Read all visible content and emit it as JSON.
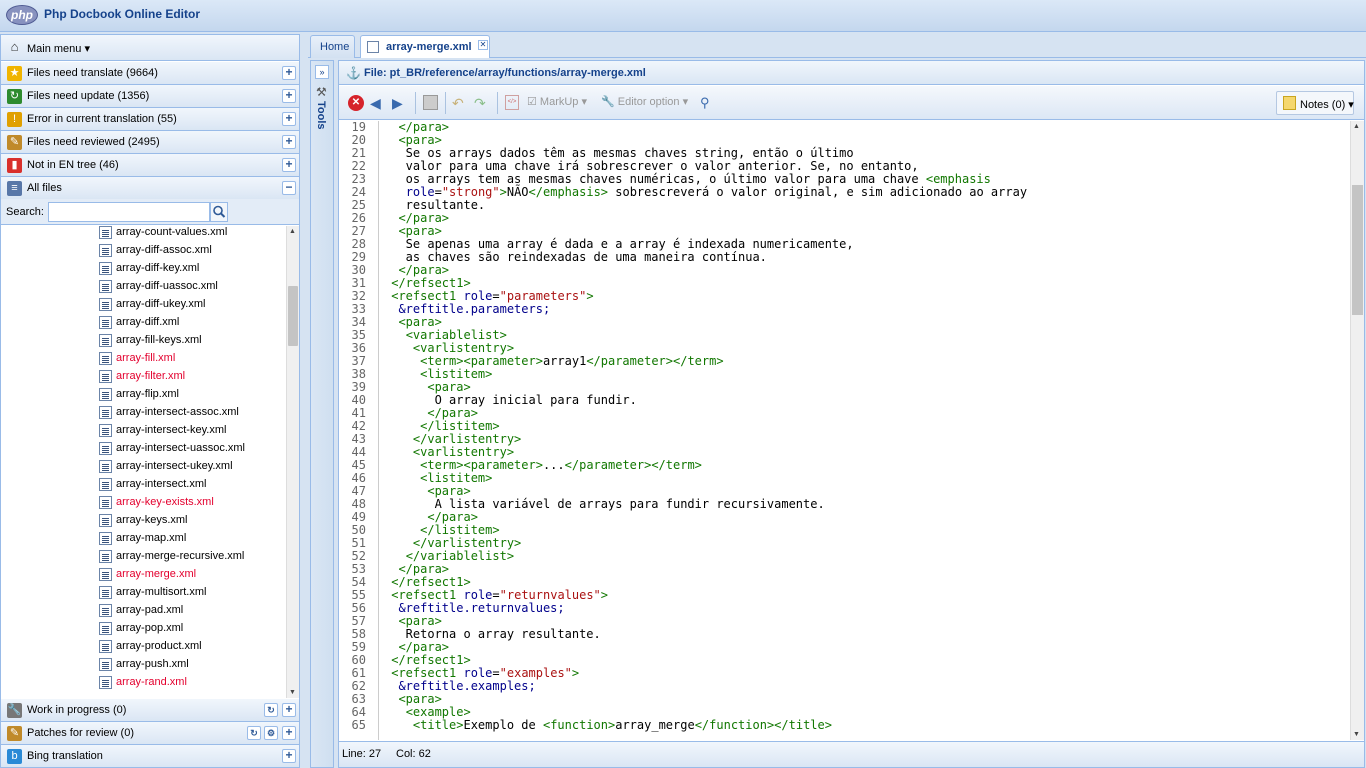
{
  "app": {
    "title": "Php Docbook Online Editor",
    "logo_text": "php"
  },
  "sidebar": {
    "main_menu": "Main menu",
    "sections": [
      {
        "label": "Files need translate (9664)",
        "icon": "translate-icon",
        "color": "#f0b400"
      },
      {
        "label": "Files need update (1356)",
        "icon": "refresh-icon",
        "color": "#2e8b2e"
      },
      {
        "label": "Error in current translation (55)",
        "icon": "warning-shield-icon",
        "color": "#e0a000"
      },
      {
        "label": "Files need reviewed (2495)",
        "icon": "pencil-icon",
        "color": "#c08a2a"
      },
      {
        "label": "Not in EN tree (46)",
        "icon": "trash-icon",
        "color": "#d9302c"
      },
      {
        "label": "All files",
        "icon": "file-list-icon",
        "color": "#5877a8"
      }
    ],
    "search": {
      "label": "Search:",
      "value": "",
      "placeholder": ""
    },
    "files": [
      {
        "name": "array-count-values.xml",
        "red": false
      },
      {
        "name": "array-diff-assoc.xml",
        "red": false
      },
      {
        "name": "array-diff-key.xml",
        "red": false
      },
      {
        "name": "array-diff-uassoc.xml",
        "red": false
      },
      {
        "name": "array-diff-ukey.xml",
        "red": false
      },
      {
        "name": "array-diff.xml",
        "red": false
      },
      {
        "name": "array-fill-keys.xml",
        "red": false
      },
      {
        "name": "array-fill.xml",
        "red": true
      },
      {
        "name": "array-filter.xml",
        "red": true
      },
      {
        "name": "array-flip.xml",
        "red": false
      },
      {
        "name": "array-intersect-assoc.xml",
        "red": false
      },
      {
        "name": "array-intersect-key.xml",
        "red": false
      },
      {
        "name": "array-intersect-uassoc.xml",
        "red": false
      },
      {
        "name": "array-intersect-ukey.xml",
        "red": false
      },
      {
        "name": "array-intersect.xml",
        "red": false
      },
      {
        "name": "array-key-exists.xml",
        "red": true
      },
      {
        "name": "array-keys.xml",
        "red": false
      },
      {
        "name": "array-map.xml",
        "red": false
      },
      {
        "name": "array-merge-recursive.xml",
        "red": false
      },
      {
        "name": "array-merge.xml",
        "red": true
      },
      {
        "name": "array-multisort.xml",
        "red": false
      },
      {
        "name": "array-pad.xml",
        "red": false
      },
      {
        "name": "array-pop.xml",
        "red": false
      },
      {
        "name": "array-product.xml",
        "red": false
      },
      {
        "name": "array-push.xml",
        "red": false
      },
      {
        "name": "array-rand.xml",
        "red": true
      }
    ],
    "bottom_sections": [
      {
        "label": "Work in progress (0)",
        "icon": "wrench-icon"
      },
      {
        "label": "Patches for review (0)",
        "icon": "patch-icon"
      },
      {
        "label": "Bing translation",
        "icon": "bing-icon"
      }
    ]
  },
  "tabs": {
    "home": "Home",
    "file": "array-merge.xml"
  },
  "tools": {
    "label": "Tools"
  },
  "editor": {
    "file_title": "File: pt_BR/reference/array/functions/array-merge.xml",
    "toolbar": {
      "markup": "MarkUp",
      "editor_option": "Editor option",
      "notes": "Notes (0)"
    },
    "status": {
      "line": "Line: 27",
      "col": "Col: 62"
    },
    "lines": [
      {
        "n": "19",
        "html": "  <span class='t'>&lt;/para&gt;</span>"
      },
      {
        "n": "20",
        "html": "  <span class='t'>&lt;para&gt;</span>"
      },
      {
        "n": "21",
        "html": "   Se os arrays dados têm as mesmas chaves string, então o último"
      },
      {
        "n": "22",
        "html": "   valor para uma chave irá sobrescrever o valor anterior. Se, no entanto,"
      },
      {
        "n": "23",
        "html": "   os arrays tem as mesmas chaves numéricas, o último valor para uma chave <span class='t'>&lt;emphasis</span>"
      },
      {
        "n": "24",
        "html": "   <span class='a'>role</span>=<span class='s'>\"strong\"</span><span class='t'>&gt;</span>NÃO<span class='t'>&lt;/emphasis&gt;</span> sobrescreverá o valor original, e sim adicionado ao array"
      },
      {
        "n": "25",
        "html": "   resultante."
      },
      {
        "n": "26",
        "html": "  <span class='t'>&lt;/para&gt;</span>"
      },
      {
        "n": "27",
        "html": "  <span class='t'>&lt;para&gt;</span>"
      },
      {
        "n": "28",
        "html": "   Se apenas uma array é dada e a array é indexada numericamente,"
      },
      {
        "n": "29",
        "html": "   as chaves são reindexadas de uma maneira contínua."
      },
      {
        "n": "30",
        "html": "  <span class='t'>&lt;/para&gt;</span>"
      },
      {
        "n": "31",
        "html": " <span class='t'>&lt;/refsect1&gt;</span>"
      },
      {
        "n": "32",
        "html": " <span class='t'>&lt;refsect1</span> <span class='a'>role</span>=<span class='s'>\"parameters\"</span><span class='t'>&gt;</span>"
      },
      {
        "n": "33",
        "html": "  <span class='e'>&amp;reftitle.parameters;</span>"
      },
      {
        "n": "34",
        "html": "  <span class='t'>&lt;para&gt;</span>"
      },
      {
        "n": "35",
        "html": "   <span class='t'>&lt;variablelist&gt;</span>"
      },
      {
        "n": "36",
        "html": "    <span class='t'>&lt;varlistentry&gt;</span>"
      },
      {
        "n": "37",
        "html": "     <span class='t'>&lt;term&gt;&lt;parameter&gt;</span>array1<span class='t'>&lt;/parameter&gt;&lt;/term&gt;</span>"
      },
      {
        "n": "38",
        "html": "     <span class='t'>&lt;listitem&gt;</span>"
      },
      {
        "n": "39",
        "html": "      <span class='t'>&lt;para&gt;</span>"
      },
      {
        "n": "40",
        "html": "       O array inicial para fundir."
      },
      {
        "n": "41",
        "html": "      <span class='t'>&lt;/para&gt;</span>"
      },
      {
        "n": "42",
        "html": "     <span class='t'>&lt;/listitem&gt;</span>"
      },
      {
        "n": "43",
        "html": "    <span class='t'>&lt;/varlistentry&gt;</span>"
      },
      {
        "n": "44",
        "html": "    <span class='t'>&lt;varlistentry&gt;</span>"
      },
      {
        "n": "45",
        "html": "     <span class='t'>&lt;term&gt;&lt;parameter&gt;</span>...<span class='t'>&lt;/parameter&gt;&lt;/term&gt;</span>"
      },
      {
        "n": "46",
        "html": "     <span class='t'>&lt;listitem&gt;</span>"
      },
      {
        "n": "47",
        "html": "      <span class='t'>&lt;para&gt;</span>"
      },
      {
        "n": "48",
        "html": "       A lista variável de arrays para fundir recursivamente."
      },
      {
        "n": "49",
        "html": "      <span class='t'>&lt;/para&gt;</span>"
      },
      {
        "n": "50",
        "html": "     <span class='t'>&lt;/listitem&gt;</span>"
      },
      {
        "n": "51",
        "html": "    <span class='t'>&lt;/varlistentry&gt;</span>"
      },
      {
        "n": "52",
        "html": "   <span class='t'>&lt;/variablelist&gt;</span>"
      },
      {
        "n": "53",
        "html": "  <span class='t'>&lt;/para&gt;</span>"
      },
      {
        "n": "54",
        "html": " <span class='t'>&lt;/refsect1&gt;</span>"
      },
      {
        "n": "55",
        "html": " <span class='t'>&lt;refsect1</span> <span class='a'>role</span>=<span class='s'>\"returnvalues\"</span><span class='t'>&gt;</span>"
      },
      {
        "n": "56",
        "html": "  <span class='e'>&amp;reftitle.returnvalues;</span>"
      },
      {
        "n": "57",
        "html": "  <span class='t'>&lt;para&gt;</span>"
      },
      {
        "n": "58",
        "html": "   Retorna o array resultante."
      },
      {
        "n": "59",
        "html": "  <span class='t'>&lt;/para&gt;</span>"
      },
      {
        "n": "60",
        "html": " <span class='t'>&lt;/refsect1&gt;</span>"
      },
      {
        "n": "61",
        "html": " <span class='t'>&lt;refsect1</span> <span class='a'>role</span>=<span class='s'>\"examples\"</span><span class='t'>&gt;</span>"
      },
      {
        "n": "62",
        "html": "  <span class='e'>&amp;reftitle.examples;</span>"
      },
      {
        "n": "63",
        "html": "  <span class='t'>&lt;para&gt;</span>"
      },
      {
        "n": "64",
        "html": "   <span class='t'>&lt;example&gt;</span>"
      },
      {
        "n": "65",
        "html": "    <span class='t'>&lt;title&gt;</span>Exemplo de <span class='t'>&lt;function&gt;</span>array_merge<span class='t'>&lt;/function&gt;&lt;/title&gt;</span>"
      }
    ]
  }
}
